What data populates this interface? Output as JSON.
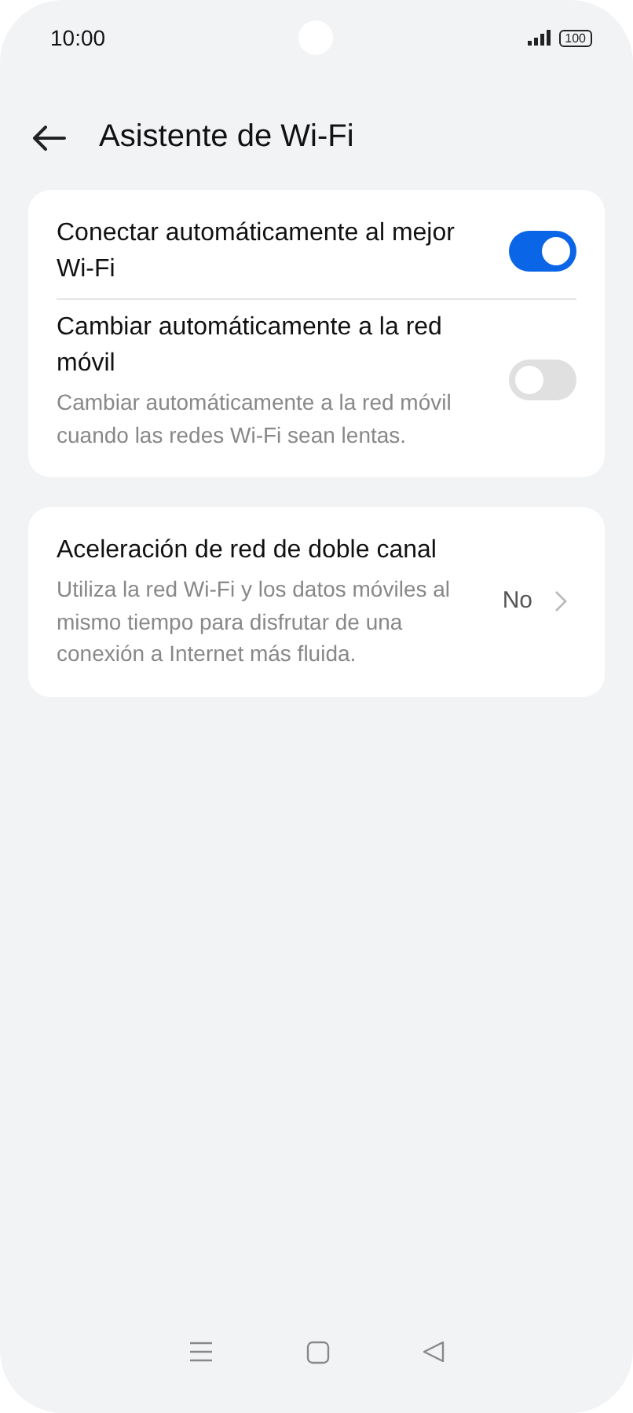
{
  "status_bar": {
    "time": "10:00",
    "battery": "100"
  },
  "header": {
    "title": "Asistente de Wi-Fi"
  },
  "cards": [
    {
      "items": [
        {
          "kind": "toggle",
          "title": "Conectar automáticamente al mejor Wi-Fi",
          "on": true
        },
        {
          "kind": "toggle",
          "title": "Cambiar automáticamente a la red móvil",
          "subtitle": "Cambiar automáticamente a la red móvil cuando las redes Wi-Fi sean lentas.",
          "on": false
        }
      ]
    },
    {
      "items": [
        {
          "kind": "link",
          "title": "Aceleración de red de doble canal",
          "subtitle": "Utiliza la red Wi-Fi y los datos móviles al mismo tiempo para disfrutar de una conexión a Internet más fluida.",
          "value": "No"
        }
      ]
    }
  ]
}
